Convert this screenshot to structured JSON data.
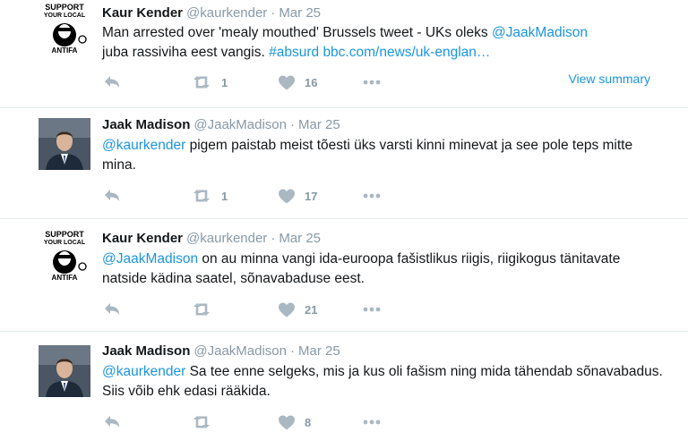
{
  "tweets": [
    {
      "fullname": "Kaur Kender",
      "username": "@kaurkender",
      "separator": "·",
      "time": "Mar 25",
      "avatar_text_top": "SUPPORT",
      "avatar_text_mid": "YOUR LOCAL",
      "avatar_text_bottom": "ANTIFA",
      "text_1": "Man arrested over 'mealy mouthed' Brussels tweet - UKs oleks ",
      "mention": "@JaakMadison",
      "text_2": "juba rassiviha eest vangis. ",
      "hashtag": "#absurd",
      "link": "bbc.com/news/uk-englan…",
      "retweets": "1",
      "likes": "16",
      "view_summary": "View summary"
    },
    {
      "fullname": "Jaak Madison",
      "username": "@JaakMadison",
      "separator": "·",
      "time": "Mar 25",
      "mention": "@kaurkender",
      "text": " pigem paistab meist tõesti üks varsti kinni minevat ja see pole teps mitte mina.",
      "retweets": "1",
      "likes": "17"
    },
    {
      "fullname": "Kaur Kender",
      "username": "@kaurkender",
      "separator": "·",
      "time": "Mar 25",
      "avatar_text_top": "SUPPORT",
      "avatar_text_mid": "YOUR LOCAL",
      "avatar_text_bottom": "ANTIFA",
      "mention": "@JaakMadison",
      "text": " on au minna vangi ida-euroopa fašistlikus riigis, riigikogus tänitavate natside kädina saatel, sõnavabaduse eest.",
      "retweets": "",
      "likes": "21"
    },
    {
      "fullname": "Jaak Madison",
      "username": "@JaakMadison",
      "separator": "·",
      "time": "Mar 25",
      "mention": "@kaurkender",
      "text": " Sa tee enne selgeks, mis ja kus oli fašism ning mida tähendab sõnavabadus. Siis võib ehk edasi rääkida.",
      "retweets": "",
      "likes": "8"
    }
  ],
  "icons": [
    "reply-icon",
    "retweet-icon",
    "heart-icon",
    "more-icon"
  ],
  "colors": {
    "link": "#1b95e0",
    "meta": "#8899a6",
    "action_icon": "#aab8c2",
    "divider": "#e6ecf0"
  }
}
